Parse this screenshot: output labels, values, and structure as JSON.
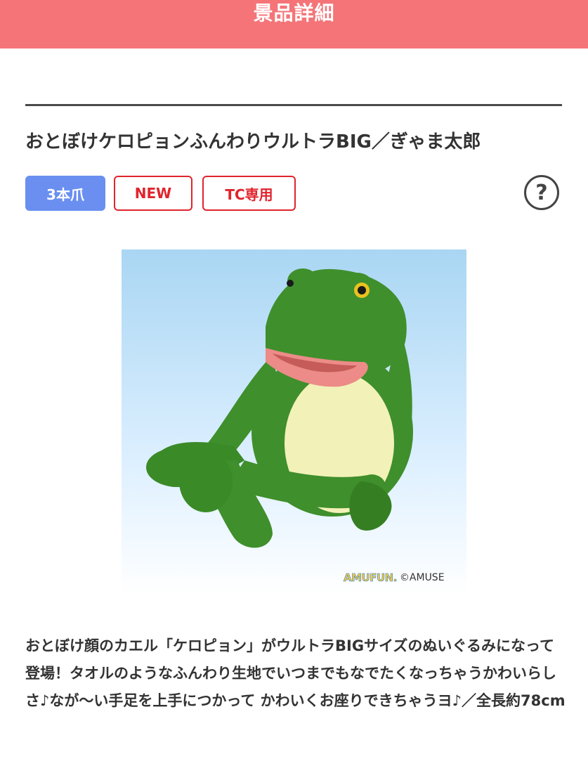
{
  "header": {
    "title": "景品詳細",
    "background_color": "#f47478"
  },
  "product": {
    "title": "おとぼけケロピョンふんわりウルトラBIG／ぎゃま太郎",
    "tags": [
      {
        "label": "3本爪",
        "style": "filled",
        "color": "#6a8ff0"
      },
      {
        "label": "NEW",
        "style": "outline",
        "color": "#e0242d"
      },
      {
        "label": "TC専用",
        "style": "outline",
        "color": "#e0242d"
      }
    ],
    "help_icon": "question-circle-icon",
    "help_label": "?",
    "image": {
      "subject": "green frog plush toy",
      "credit_logo": "AMUFUN.",
      "credit_copyright": "©AMUSE"
    },
    "description": "おとぼけ顔のカエル「ケロピョン」がウルトラBIGサイズのぬいぐるみになって登場！タオルのようなふんわり生地でいつまでもなでたくなっちゃうかわいらしさ♪なが〜い手足を上手につかって かわいくお座りできちゃうヨ♪／全長約78cm"
  }
}
